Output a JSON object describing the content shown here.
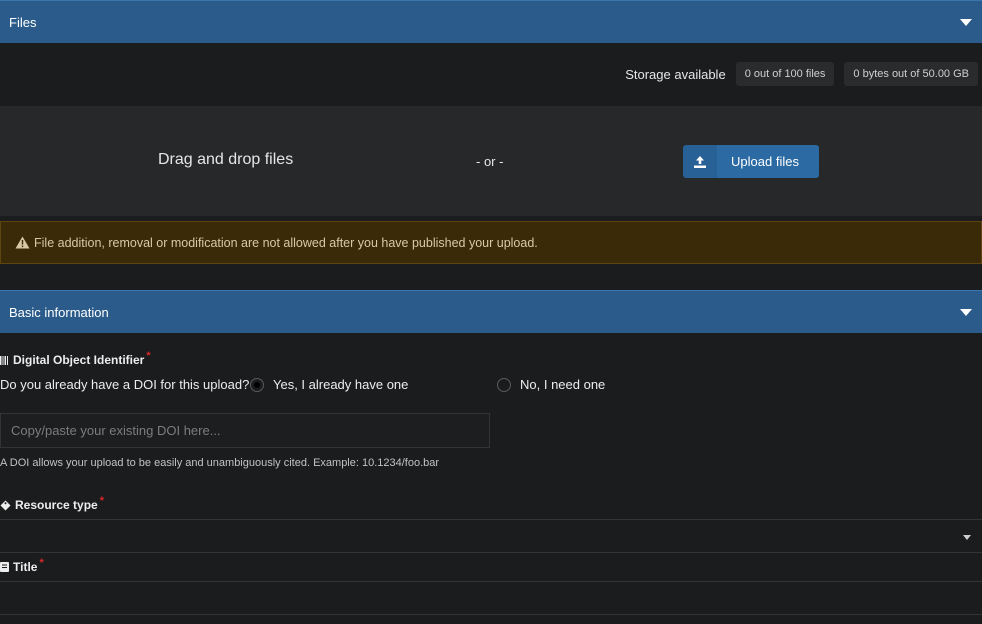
{
  "files_section": {
    "title": "Files"
  },
  "storage": {
    "label": "Storage available",
    "files_badge": "0 out of 100 files",
    "bytes_badge": "0 bytes out of 50.00 GB"
  },
  "dropzone": {
    "text": "Drag and drop files",
    "or_text": "- or -",
    "upload_label": "Upload files"
  },
  "warning": {
    "text": "File addition, removal or modification are not allowed after you have published your upload."
  },
  "basic_section": {
    "title": "Basic information"
  },
  "doi": {
    "label": "Digital Object Identifier",
    "question": "Do you already have a DOI for this upload?",
    "option_yes": "Yes, I already have one",
    "option_no": "No, I need one",
    "selected": "yes",
    "placeholder": "Copy/paste your existing DOI here...",
    "help": "A DOI allows your upload to be easily and unambiguously cited. Example: 10.1234/foo.bar"
  },
  "resource_type": {
    "label": "Resource type"
  },
  "title_field": {
    "label": "Title"
  },
  "icons": {
    "caret": "caret-down-icon",
    "upload": "upload-icon",
    "warning": "warning-icon",
    "barcode": "barcode-icon",
    "tag": "tag-icon",
    "book": "book-icon"
  },
  "colors": {
    "header_bg": "#2a5b8a",
    "upload_btn": "#2b6aa3",
    "warning_bg": "#3a2a08",
    "required": "#db2828"
  }
}
